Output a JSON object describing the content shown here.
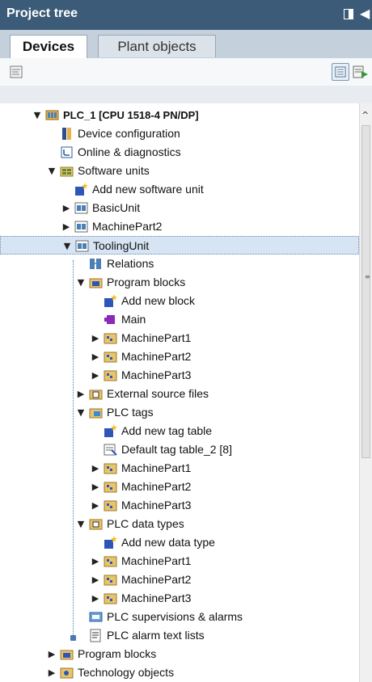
{
  "panel": {
    "title": "Project tree",
    "pin_icon": "pin-panel-icon",
    "collapse_icon": "collapse-left-icon",
    "collapse_glyph": "◀"
  },
  "tabs": [
    {
      "label": "Devices",
      "active": true
    },
    {
      "label": "Plant objects",
      "active": false
    }
  ],
  "toolbar": {
    "left_icon": "project-view-icon",
    "right_icons": [
      "overview-icon",
      "add-device-icon"
    ]
  },
  "tree": [
    {
      "label": "PLC_1 [CPU 1518-4 PN/DP]",
      "indent": 0,
      "arrow": "▼",
      "icon": "plc-icon",
      "bold": true
    },
    {
      "label": "Device configuration",
      "indent": 1,
      "arrow": "",
      "icon": "device-configuration-icon"
    },
    {
      "label": "Online & diagnostics",
      "indent": 1,
      "arrow": "",
      "icon": "online-diagnostics-icon"
    },
    {
      "label": "Software units",
      "indent": 1,
      "arrow": "▼",
      "icon": "software-units-folder-icon"
    },
    {
      "label": "Add new software unit",
      "indent": 2,
      "arrow": "",
      "icon": "add-new-icon"
    },
    {
      "label": "BasicUnit",
      "indent": 2,
      "arrow": "▶",
      "icon": "software-unit-icon"
    },
    {
      "label": "MachinePart2",
      "indent": 2,
      "arrow": "▶",
      "icon": "software-unit-icon"
    },
    {
      "label": "ToolingUnit",
      "indent": 2,
      "arrow": "▼",
      "icon": "software-unit-icon",
      "selected": true
    },
    {
      "label": "Relations",
      "indent": 3,
      "arrow": "",
      "icon": "relations-icon"
    },
    {
      "label": "Program blocks",
      "indent": 3,
      "arrow": "▼",
      "icon": "program-blocks-folder-icon"
    },
    {
      "label": "Add new block",
      "indent": 4,
      "arrow": "",
      "icon": "add-new-icon"
    },
    {
      "label": "Main",
      "indent": 4,
      "arrow": "",
      "icon": "organization-block-icon"
    },
    {
      "label": "MachinePart1",
      "indent": 4,
      "arrow": "▶",
      "icon": "namespace-folder-icon"
    },
    {
      "label": "MachinePart2",
      "indent": 4,
      "arrow": "▶",
      "icon": "namespace-folder-icon"
    },
    {
      "label": "MachinePart3",
      "indent": 4,
      "arrow": "▶",
      "icon": "namespace-folder-icon"
    },
    {
      "label": "External source files",
      "indent": 3,
      "arrow": "▶",
      "icon": "external-source-folder-icon"
    },
    {
      "label": "PLC tags",
      "indent": 3,
      "arrow": "▼",
      "icon": "plc-tags-folder-icon"
    },
    {
      "label": "Add new tag table",
      "indent": 4,
      "arrow": "",
      "icon": "add-new-icon"
    },
    {
      "label": "Default tag table_2 [8]",
      "indent": 4,
      "arrow": "",
      "icon": "tag-table-icon"
    },
    {
      "label": "MachinePart1",
      "indent": 4,
      "arrow": "▶",
      "icon": "namespace-folder-icon"
    },
    {
      "label": "MachinePart2",
      "indent": 4,
      "arrow": "▶",
      "icon": "namespace-folder-icon"
    },
    {
      "label": "MachinePart3",
      "indent": 4,
      "arrow": "▶",
      "icon": "namespace-folder-icon"
    },
    {
      "label": "PLC data types",
      "indent": 3,
      "arrow": "▼",
      "icon": "plc-data-types-folder-icon"
    },
    {
      "label": "Add new data type",
      "indent": 4,
      "arrow": "",
      "icon": "add-new-icon"
    },
    {
      "label": "MachinePart1",
      "indent": 4,
      "arrow": "▶",
      "icon": "namespace-folder-icon"
    },
    {
      "label": "MachinePart2",
      "indent": 4,
      "arrow": "▶",
      "icon": "namespace-folder-icon"
    },
    {
      "label": "MachinePart3",
      "indent": 4,
      "arrow": "▶",
      "icon": "namespace-folder-icon"
    },
    {
      "label": "PLC supervisions & alarms",
      "indent": 3,
      "arrow": "",
      "icon": "supervisions-alarms-icon"
    },
    {
      "label": "PLC alarm text lists",
      "indent": 3,
      "arrow": "",
      "icon": "alarm-text-lists-icon"
    },
    {
      "label": "Program blocks",
      "indent": 1,
      "arrow": "▶",
      "icon": "program-blocks-folder-icon"
    },
    {
      "label": "Technology objects",
      "indent": 1,
      "arrow": "▶",
      "icon": "technology-objects-icon"
    }
  ],
  "scrollbar": {
    "up_glyph": "^",
    "grip_glyph": "≡"
  }
}
